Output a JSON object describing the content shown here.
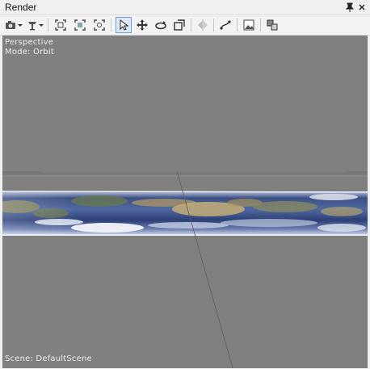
{
  "window": {
    "title": "Render"
  },
  "titlebar_buttons": {
    "pin_icon": "pin-icon",
    "close_icon": "close-icon"
  },
  "viewport": {
    "projection_label": "Perspective",
    "mode_label": "Mode: Orbit",
    "scene_label": "Scene: DefaultScene",
    "background_color": "#808080"
  },
  "toolbar": {
    "icons": [
      "camera-icon",
      "lamp-icon",
      "zoom-extents-icon",
      "zoom-selected-icon",
      "zoom-region-icon",
      "select-arrow-icon",
      "move-icon",
      "rotate-icon",
      "scale-icon",
      "mirror-icon",
      "path-icon",
      "image-icon",
      "layers-icon"
    ],
    "active_tool": "select-arrow-icon"
  }
}
